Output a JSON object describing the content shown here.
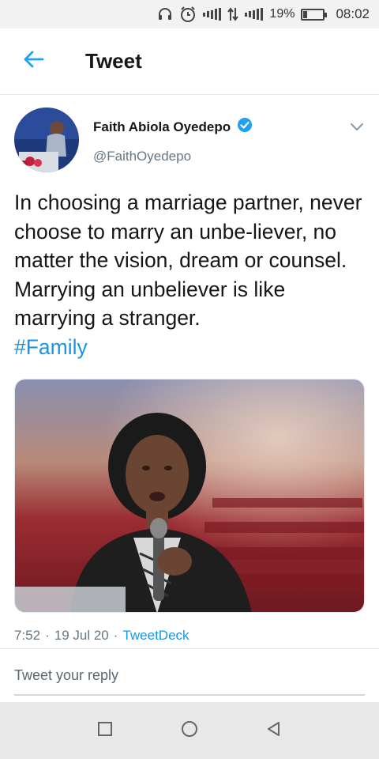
{
  "status_bar": {
    "battery": "19%",
    "battery_level": 0.19,
    "time": "08:02",
    "icons": [
      "headset-icon",
      "alarm-icon",
      "signal-hd-icon",
      "data-arrows-icon",
      "signal-hd-icon",
      "battery-icon"
    ]
  },
  "header": {
    "back_icon": "arrow-left-icon",
    "title": "Tweet"
  },
  "author": {
    "name": "Faith Abiola Oyedepo",
    "handle": "@FaithOyedepo",
    "verified": true,
    "menu_icon": "chevron-down-icon"
  },
  "tweet": {
    "text": "In choosing a marriage partner, never choose to marry an unbe-liever, no matter the vision, dream or counsel. Marrying an unbeliever is like marrying a stranger.",
    "hashtag": "#Family",
    "time": "7:52",
    "date": "19 Jul 20",
    "source": "TweetDeck",
    "separator": "·"
  },
  "reply": {
    "placeholder": "Tweet your reply"
  },
  "nav": {
    "buttons": [
      "recents-square-icon",
      "home-circle-icon",
      "back-triangle-icon"
    ]
  },
  "colors": {
    "accent": "#1b95e0",
    "secondary_text": "#657786",
    "verified": "#1da1f2"
  }
}
